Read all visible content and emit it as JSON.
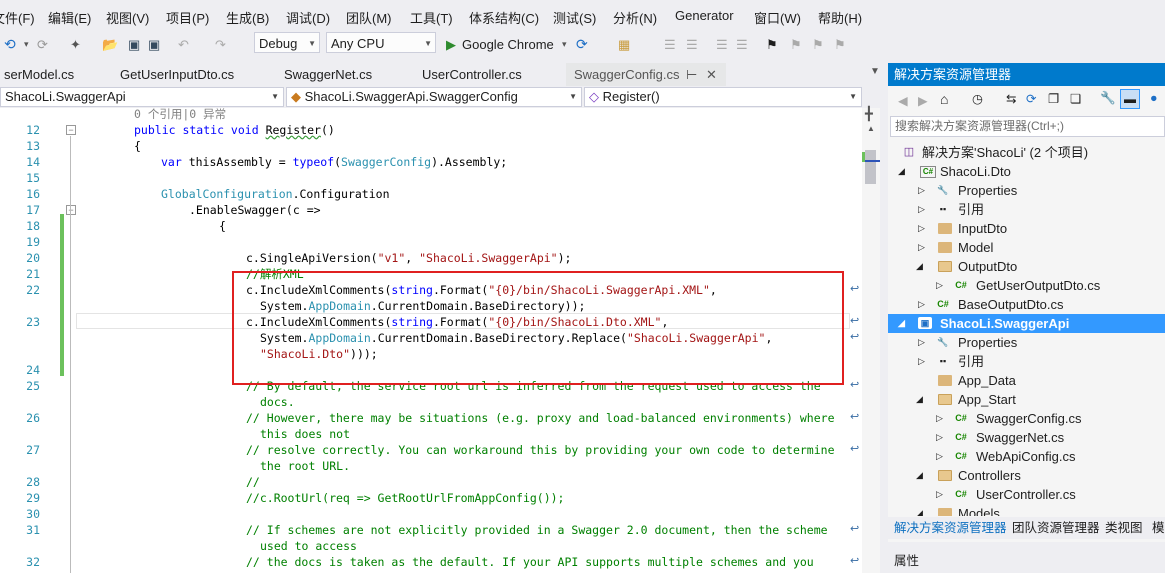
{
  "menu": [
    "文件(F)",
    "编辑(E)",
    "视图(V)",
    "项目(P)",
    "生成(B)",
    "调试(D)",
    "团队(M)",
    "工具(T)",
    "体系结构(C)",
    "测试(S)",
    "分析(N)",
    "Generator",
    "窗口(W)",
    "帮助(H)"
  ],
  "toolbar": {
    "config": "Debug",
    "platform": "Any CPU",
    "browser": "Google Chrome"
  },
  "tabs": [
    {
      "label": "serModel.cs"
    },
    {
      "label": "GetUserInputDto.cs"
    },
    {
      "label": "SwaggerNet.cs"
    },
    {
      "label": "UserController.cs"
    },
    {
      "label": "SwaggerConfig.cs",
      "active": true
    }
  ],
  "navbar": {
    "project": "ShacoLi.SwaggerApi",
    "class": "ShacoLi.SwaggerApi.SwaggerConfig",
    "member": "Register()"
  },
  "editor": {
    "codelens": "0 个引用|0 异常",
    "line_numbers": [
      "12",
      "13",
      "14",
      "15",
      "16",
      "17",
      "18",
      "19",
      "20",
      "21",
      "22",
      "23",
      "24",
      "25",
      "26",
      "27",
      "28",
      "29",
      "30",
      "31",
      "32"
    ]
  },
  "solution_explorer": {
    "title": "解决方案资源管理器",
    "search_placeholder": "搜索解决方案资源管理器(Ctrl+;)",
    "bottom_tabs": [
      "解决方案资源管理器",
      "团队资源管理器",
      "类视图",
      "模"
    ],
    "properties_title": "属性",
    "tree": [
      {
        "label": "解决方案'ShacoLi' (2 个项目)"
      },
      {
        "label": "ShacoLi.Dto"
      },
      {
        "label": "Properties"
      },
      {
        "label": "引用"
      },
      {
        "label": "InputDto"
      },
      {
        "label": "Model"
      },
      {
        "label": "OutputDto"
      },
      {
        "label": "GetUserOutputDto.cs"
      },
      {
        "label": "BaseOutputDto.cs"
      },
      {
        "label": "ShacoLi.SwaggerApi"
      },
      {
        "label": "Properties"
      },
      {
        "label": "引用"
      },
      {
        "label": "App_Data"
      },
      {
        "label": "App_Start"
      },
      {
        "label": "SwaggerConfig.cs"
      },
      {
        "label": "SwaggerNet.cs"
      },
      {
        "label": "WebApiConfig.cs"
      },
      {
        "label": "Controllers"
      },
      {
        "label": "UserController.cs"
      },
      {
        "label": "Models"
      }
    ]
  },
  "colors": {
    "highlight_box": "#e02020",
    "selection": "#3399ff",
    "change_bar": "#6cc15c"
  }
}
